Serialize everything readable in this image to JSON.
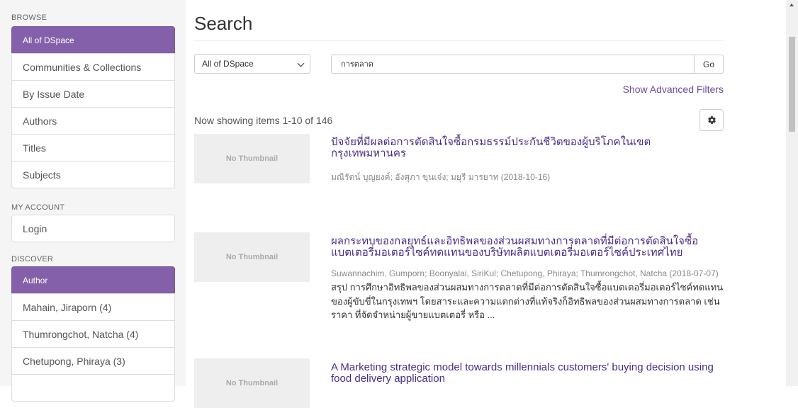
{
  "sidebar": {
    "browse_label": "BROWSE",
    "browse_items": [
      {
        "label": "All of DSpace"
      },
      {
        "label": "Communities & Collections"
      },
      {
        "label": "By Issue Date"
      },
      {
        "label": "Authors"
      },
      {
        "label": "Titles"
      },
      {
        "label": "Subjects"
      }
    ],
    "account_label": "MY ACCOUNT",
    "account_items": [
      {
        "label": "Login"
      }
    ],
    "discover_label": "DISCOVER",
    "discover_items": [
      {
        "label": "Author"
      },
      {
        "label": "Mahain, Jiraporn (4)"
      },
      {
        "label": "Thumrongchot, Natcha (4)"
      },
      {
        "label": "Chetupong, Phiraya (3)"
      }
    ]
  },
  "main": {
    "title": "Search",
    "scope_value": "All of DSpace",
    "query_value": "การตลาด",
    "go_label": "Go",
    "advanced_filters_link": "Show Advanced Filters",
    "showing_text": "Now showing items 1-10 of 146",
    "results": [
      {
        "thumbnail": "No Thumbnail",
        "title": "ปัจจัยที่มีผลต่อการตัดสินใจซื้อกรมธรรม์ประกันชีวิตของผู้บริโภคในเขตกรุงเทพมหานคร",
        "meta": "มณีรัตน์ บุญยงค์; อังศุภา ขุนเจ๋ง; มยุรี มารยาท (2018-10-16)",
        "abstract": ""
      },
      {
        "thumbnail": "No Thumbnail",
        "title": "ผลกระทบของกลยุทธ์และอิทธิพลของส่วนผสมทางการตลาดที่มีต่อการตัดสินใจซื้อแบตเตอรี่มอเตอร์ไซค์ทดแทนของบริษัทผลิตแบตเตอรี่มอเตอร์ไซค์ประเทศไทย",
        "meta": "Suwannachim, Gumporn; Boonyalai, SiriKul; Chetupong, Phiraya; Thumrongchot, Natcha (2018-07-07)",
        "abstract": "สรุป การศึกษาอิทธิพลของส่วนผสมทางการตลาดที่มีต่อการตัดสินใจซื้อแบตเตอรี่มอเตอร์ไซค์ทดแทนของผู้ขับขี่ในกรุงเทพฯ โดยสาระและความแตกต่างที่แท้จริงก็อิทธิพลของส่วนผสมทางการตลาด เช่น ราคา ที่จัดจำหน่ายผู้ขายแบตเตอรี่ หรือ ..."
      },
      {
        "thumbnail": "No Thumbnail",
        "title": "A Marketing strategic model towards millennials customers' buying decision using food delivery application",
        "meta": "",
        "abstract": ""
      }
    ]
  },
  "colors": {
    "accent": "#8460ab",
    "link": "#4b2d86",
    "sidebar_bg": "#f5f5f5"
  },
  "icons": {
    "settings": "gear-icon",
    "scope_dropdown": "chevron-down-icon"
  }
}
